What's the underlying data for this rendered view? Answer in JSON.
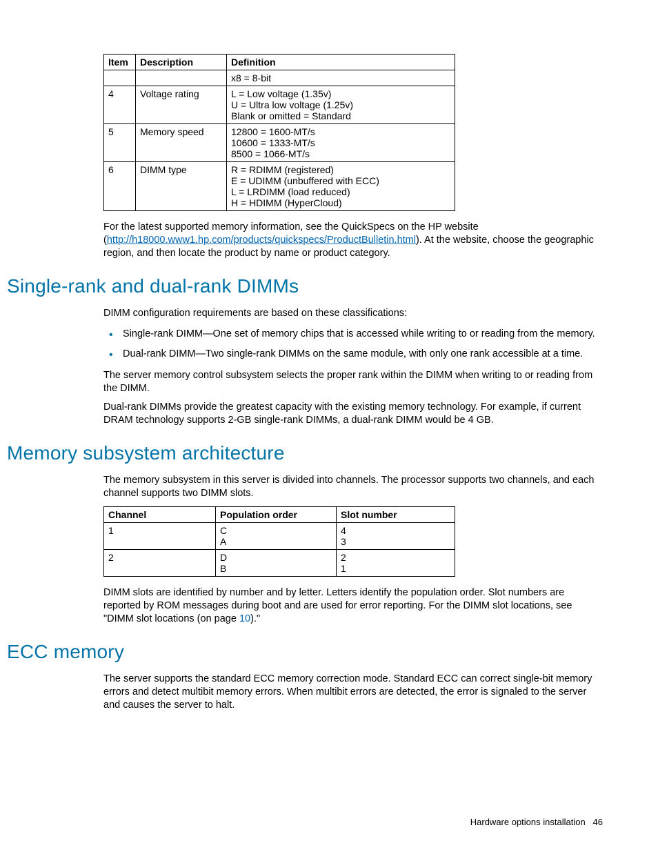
{
  "table1": {
    "headers": {
      "item": "Item",
      "desc": "Description",
      "def": "Definition"
    },
    "rows": [
      {
        "item": "",
        "desc": "",
        "def": "x8 = 8-bit"
      },
      {
        "item": "4",
        "desc": "Voltage rating",
        "def": "L = Low voltage (1.35v)\nU = Ultra low voltage (1.25v)\nBlank or omitted = Standard"
      },
      {
        "item": "5",
        "desc": "Memory speed",
        "def": "12800 = 1600-MT/s\n10600 = 1333-MT/s\n8500 = 1066-MT/s"
      },
      {
        "item": "6",
        "desc": "DIMM type",
        "def": "R = RDIMM (registered)\nE = UDIMM (unbuffered with ECC)\nL = LRDIMM (load reduced)\nH = HDIMM (HyperCloud)"
      }
    ]
  },
  "para_quickspecs_pre": "For the latest supported memory information, see the QuickSpecs on the HP website (",
  "quickspecs_url": "http://h18000.www1.hp.com/products/quickspecs/ProductBulletin.html",
  "para_quickspecs_post": "). At the website, choose the geographic region, and then locate the product by name or product category.",
  "h_single_dual": "Single-rank and dual-rank DIMMs",
  "p_sd_intro": "DIMM configuration requirements are based on these classifications:",
  "sd_bullets": [
    "Single-rank DIMM—One set of memory chips that is accessed while writing to or reading from the memory.",
    "Dual-rank DIMM—Two single-rank DIMMs on the same module, with only one rank accessible at a time."
  ],
  "p_sd_2": "The server memory control subsystem selects the proper rank within the DIMM when writing to or reading from the DIMM.",
  "p_sd_3": "Dual-rank DIMMs provide the greatest capacity with the existing memory technology. For example, if current DRAM technology supports 2-GB single-rank DIMMs, a dual-rank DIMM would be 4 GB.",
  "h_memarch": "Memory subsystem architecture",
  "p_ma_intro": "The memory subsystem in this server is divided into channels. The processor supports two channels, and each channel supports two DIMM slots.",
  "table2": {
    "headers": {
      "chan": "Channel",
      "pop": "Population order",
      "slot": "Slot number"
    },
    "rows": [
      {
        "chan": "1",
        "pop": "C\nA",
        "slot": "4\n3"
      },
      {
        "chan": "2",
        "pop": "D\nB",
        "slot": "2\n1"
      }
    ]
  },
  "p_ma_2_pre": "DIMM slots are identified by number and by letter. Letters identify the population order. Slot numbers are reported by ROM messages during boot and are used for error reporting. For the DIMM slot locations, see \"DIMM slot locations (on page ",
  "p_ma_2_link": "10",
  "p_ma_2_post": ").\"",
  "h_ecc": "ECC memory",
  "p_ecc": "The server supports the standard ECC memory correction mode. Standard ECC can correct single-bit memory errors and detect multibit memory errors. When multibit errors are detected, the error is signaled to the server and causes the server to halt.",
  "footer_text": "Hardware options installation",
  "footer_page": "46"
}
